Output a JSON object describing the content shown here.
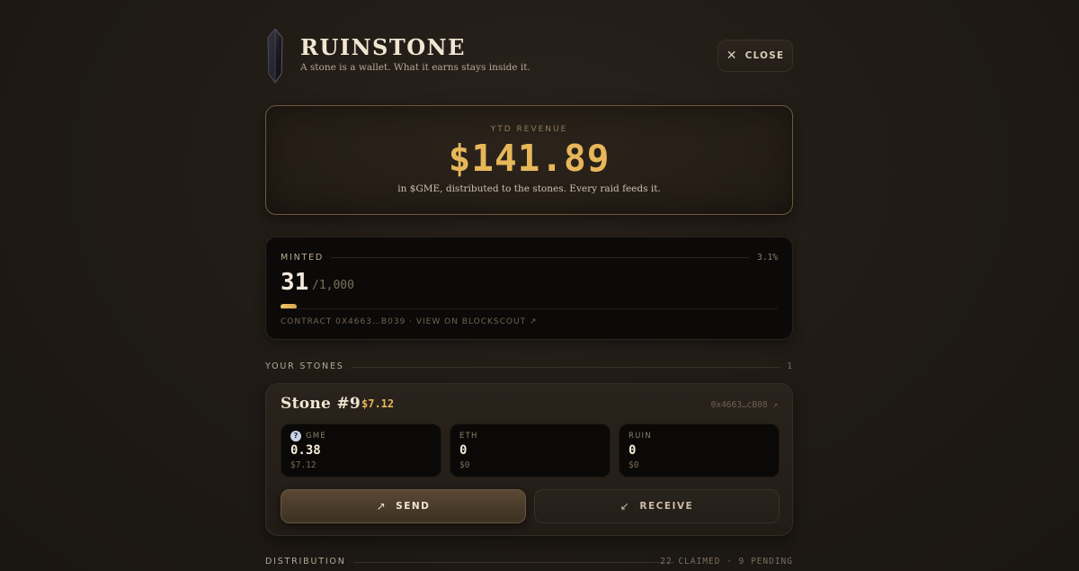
{
  "header": {
    "brand": "RUINSTONE",
    "tagline": "A stone is a wallet. What it earns stays inside it.",
    "close_label": "CLOSE"
  },
  "revenue": {
    "label": "YTD REVENUE",
    "value": "$141.89",
    "subtitle": "in $GME, distributed to the stones. Every raid feeds it."
  },
  "minted": {
    "label": "MINTED",
    "percent": "3.1%",
    "count": "31",
    "total": "/1,000",
    "progress_fraction": 0.031,
    "contract_link": "CONTRACT 0X4663…B039 · VIEW ON BLOCKSCOUT ↗"
  },
  "your_stones": {
    "label": "YOUR STONES",
    "count": "1",
    "stones": [
      {
        "name": "Stone #9",
        "value": "$7.12",
        "address": "0x4663…cB08 ↗",
        "tokens": [
          {
            "symbol": "GME",
            "amount": "0.38",
            "usd": "$7.12",
            "icon": "gme-token-icon"
          },
          {
            "symbol": "ETH",
            "amount": "0",
            "usd": "$0"
          },
          {
            "symbol": "RUIN",
            "amount": "0",
            "usd": "$0"
          }
        ],
        "send_label": "SEND",
        "receive_label": "RECEIVE"
      }
    ]
  },
  "distribution": {
    "label": "DISTRIBUTION",
    "status": "22 CLAIMED · 9 PENDING"
  },
  "colors": {
    "accent_gold": "#e7b75a",
    "background": "#1f1a15",
    "card_dark": "#0c0a08"
  }
}
